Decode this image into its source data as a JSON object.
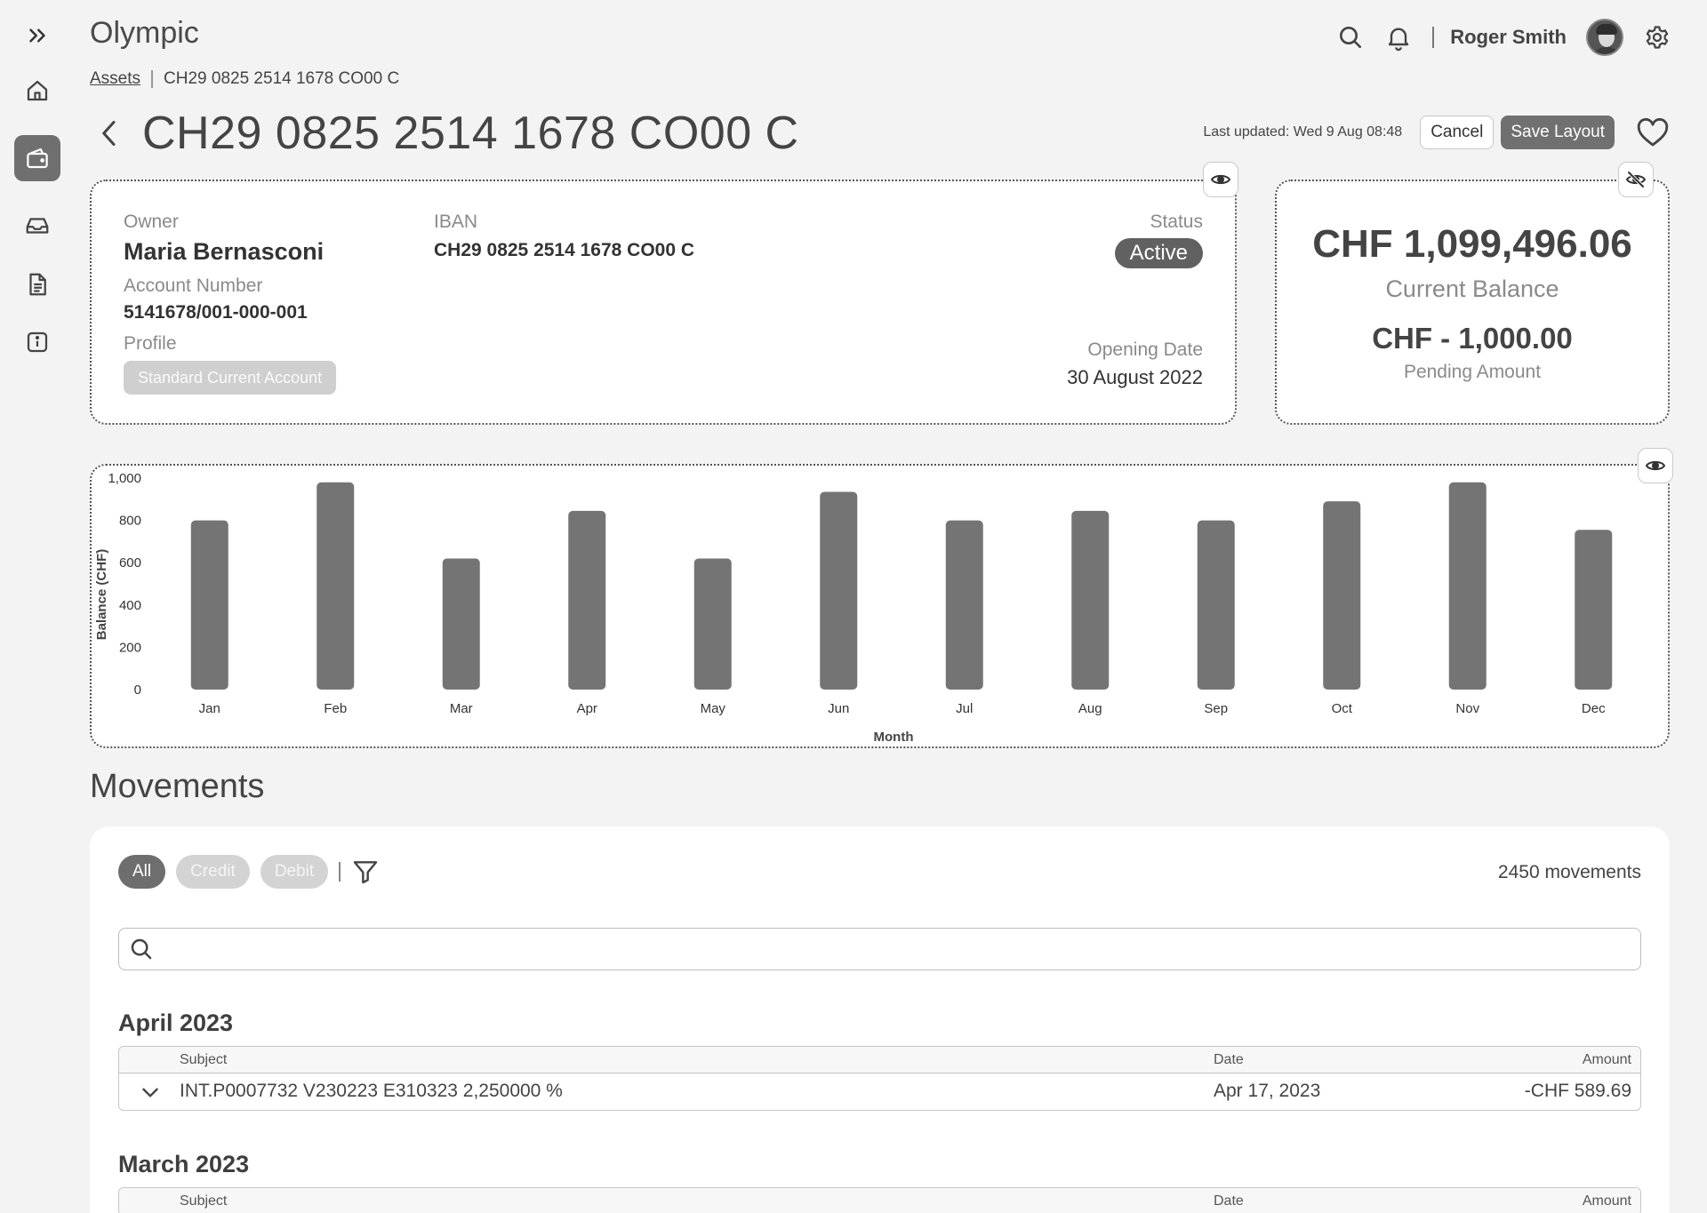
{
  "app": {
    "title": "Olympic"
  },
  "user": {
    "name": "Roger Smith"
  },
  "breadcrumb": {
    "root": "Assets",
    "current": "CH29 0825 2514 1678 CO00 C"
  },
  "page": {
    "title": "CH29 0825 2514 1678 CO00 C",
    "last_updated": "Last updated: Wed 9 Aug 08:48",
    "cancel_label": "Cancel",
    "save_label": "Save Layout"
  },
  "sidebar": {
    "items": [
      {
        "icon": "expand-icon"
      },
      {
        "icon": "home-icon"
      },
      {
        "icon": "wallet-icon",
        "active": true
      },
      {
        "icon": "inbox-icon"
      },
      {
        "icon": "document-icon"
      },
      {
        "icon": "info-icon"
      }
    ]
  },
  "account": {
    "owner_label": "Owner",
    "owner": "Maria Bernasconi",
    "account_number_label": "Account Number",
    "account_number": "5141678/001-000-001",
    "profile_label": "Profile",
    "profile": "Standard Current Account",
    "iban_label": "IBAN",
    "iban": "CH29 0825 2514 1678 CO00 C",
    "status_label": "Status",
    "status": "Active",
    "opening_date_label": "Opening Date",
    "opening_date": "30 August 2022"
  },
  "balance": {
    "current_balance": "CHF 1,099,496.06",
    "current_balance_label": "Current Balance",
    "pending_amount": "CHF - 1,000.00",
    "pending_amount_label": "Pending Amount"
  },
  "chart_data": {
    "type": "bar",
    "categories": [
      "Jan",
      "Feb",
      "Mar",
      "Apr",
      "May",
      "Jun",
      "Jul",
      "Aug",
      "Sep",
      "Oct",
      "Nov",
      "Dec"
    ],
    "values": [
      800,
      980,
      620,
      845,
      620,
      935,
      800,
      845,
      800,
      890,
      980,
      755
    ],
    "xlabel": "Month",
    "ylabel": "Balance (CHF)",
    "ylim": [
      0,
      1000
    ],
    "yticks": [
      0,
      200,
      400,
      600,
      800,
      "1,000"
    ],
    "grid": false,
    "bar_color": "#747474"
  },
  "movements": {
    "title": "Movements",
    "filters": [
      "All",
      "Credit",
      "Debit"
    ],
    "active_filter": "All",
    "count": "2450 movements",
    "search_placeholder": "",
    "groups": [
      {
        "month": "April 2023",
        "headers": {
          "subject": "Subject",
          "date": "Date",
          "amount": "Amount"
        },
        "rows": [
          {
            "subject": "INT.P0007732 V230223 E310323 2,250000 %",
            "date": "Apr 17, 2023",
            "amount": "-CHF 589.69"
          }
        ]
      },
      {
        "month": "March 2023",
        "headers": {
          "subject": "Subject",
          "date": "Date",
          "amount": "Amount"
        },
        "rows": []
      }
    ]
  },
  "colors": {
    "accent": "#6e6e6e",
    "background": "#f3f3f3",
    "card": "#ffffff"
  }
}
